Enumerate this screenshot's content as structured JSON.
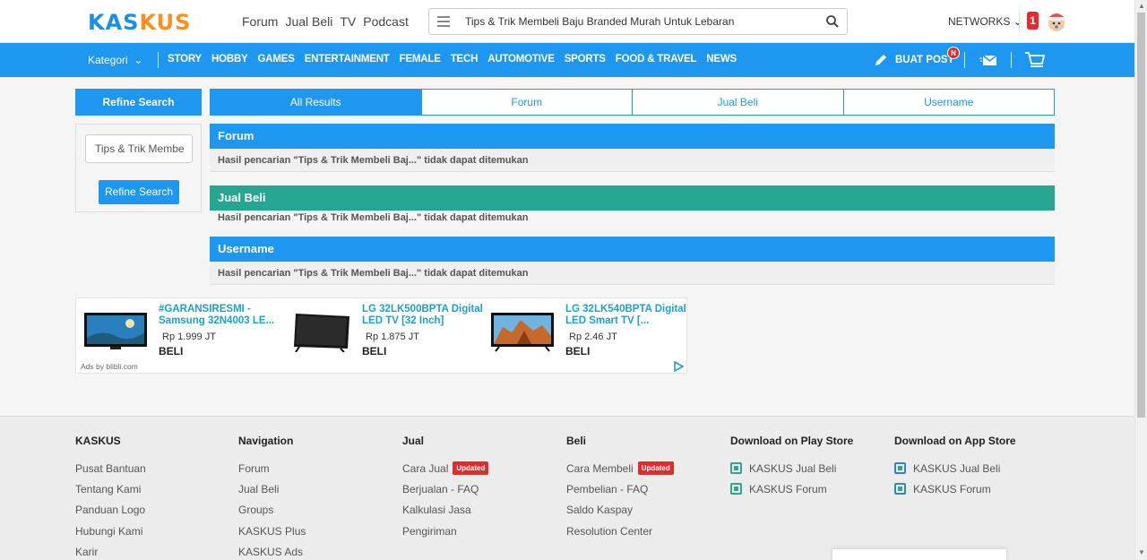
{
  "header": {
    "logo": {
      "part1": "KAS",
      "part2": "KUS"
    },
    "nav": [
      "Forum",
      "Jual Beli",
      "TV",
      "Podcast"
    ],
    "search_value": "Tips & Trik Membeli Baju Branded Murah Untuk Lebaran",
    "networks_label": "NETWORKS",
    "notification_count": "1"
  },
  "category_nav": {
    "kategori_label": "Kategori",
    "items": [
      "STORY",
      "HOBBY",
      "GAMES",
      "ENTERTAINMENT",
      "FEMALE",
      "TECH",
      "AUTOMOTIVE",
      "SPORTS",
      "FOOD & TRAVEL",
      "NEWS"
    ],
    "buat_post_label": "BUAT POST",
    "new_badge": "N"
  },
  "sidebar": {
    "title": "Refine Search",
    "input_value": "Tips & Trik Membe",
    "button_label": "Refine Search"
  },
  "tabs": [
    {
      "label": "All Results",
      "active": true
    },
    {
      "label": "Forum",
      "active": false
    },
    {
      "label": "Jual Beli",
      "active": false
    },
    {
      "label": "Username",
      "active": false
    }
  ],
  "sections": [
    {
      "title": "Forum",
      "message": "Hasil pencarian \"Tips & Trik Membeli Baj...\" tidak dapat ditemukan",
      "color": "#1e97f0"
    },
    {
      "title": "Jual Beli",
      "message": "Hasil pencarian \"Tips & Trik Membeli Baj...\" tidak dapat ditemukan",
      "color": "#26a590"
    },
    {
      "title": "Username",
      "message": "Hasil pencarian \"Tips & Trik Membeli Baj...\" tidak dapat ditemukan",
      "color": "#1e97f0"
    }
  ],
  "ads": {
    "items": [
      {
        "title": "#GARANSIRESMI - Samsung 32N4003 LE...",
        "price": "Rp 1.999 JT",
        "cta": "BELI"
      },
      {
        "title": "LG 32LK500BPTA Digital LED TV [32 Inch]",
        "price": "Rp 1.875 JT",
        "cta": "BELI"
      },
      {
        "title": "LG 32LK540BPTA Digital LED Smart TV [...",
        "price": "Rp 2.46 JT",
        "cta": "BELI"
      }
    ],
    "ads_by": "Ads by blibli.com"
  },
  "footer": {
    "columns": [
      {
        "title": "KASKUS",
        "links": [
          {
            "label": "Pusat Bantuan"
          },
          {
            "label": "Tentang Kami"
          },
          {
            "label": "Panduan Logo"
          },
          {
            "label": "Hubungi Kami"
          },
          {
            "label": "Karir"
          }
        ]
      },
      {
        "title": "Navigation",
        "links": [
          {
            "label": "Forum"
          },
          {
            "label": "Jual Beli"
          },
          {
            "label": "Groups"
          },
          {
            "label": "KASKUS Plus"
          },
          {
            "label": "KASKUS Ads"
          }
        ]
      },
      {
        "title": "Jual",
        "links": [
          {
            "label": "Cara Jual",
            "badge": "Updated"
          },
          {
            "label": "Berjualan - FAQ"
          },
          {
            "label": "Kalkulasi Jasa"
          },
          {
            "label": "Pengiriman"
          }
        ]
      },
      {
        "title": "Beli",
        "links": [
          {
            "label": "Cara Membeli",
            "badge": "Updated"
          },
          {
            "label": "Pembelian - FAQ"
          },
          {
            "label": "Saldo Kaspay"
          },
          {
            "label": "Resolution Center"
          }
        ]
      },
      {
        "title": "Download on Play Store",
        "links": [
          {
            "label": "KASKUS Jual Beli",
            "store": true
          },
          {
            "label": "KASKUS Forum",
            "store": true
          }
        ]
      },
      {
        "title": "Download on App Store",
        "links": [
          {
            "label": "KASKUS Jual Beli",
            "store": true
          },
          {
            "label": "KASKUS Forum",
            "store": true
          }
        ]
      }
    ]
  }
}
